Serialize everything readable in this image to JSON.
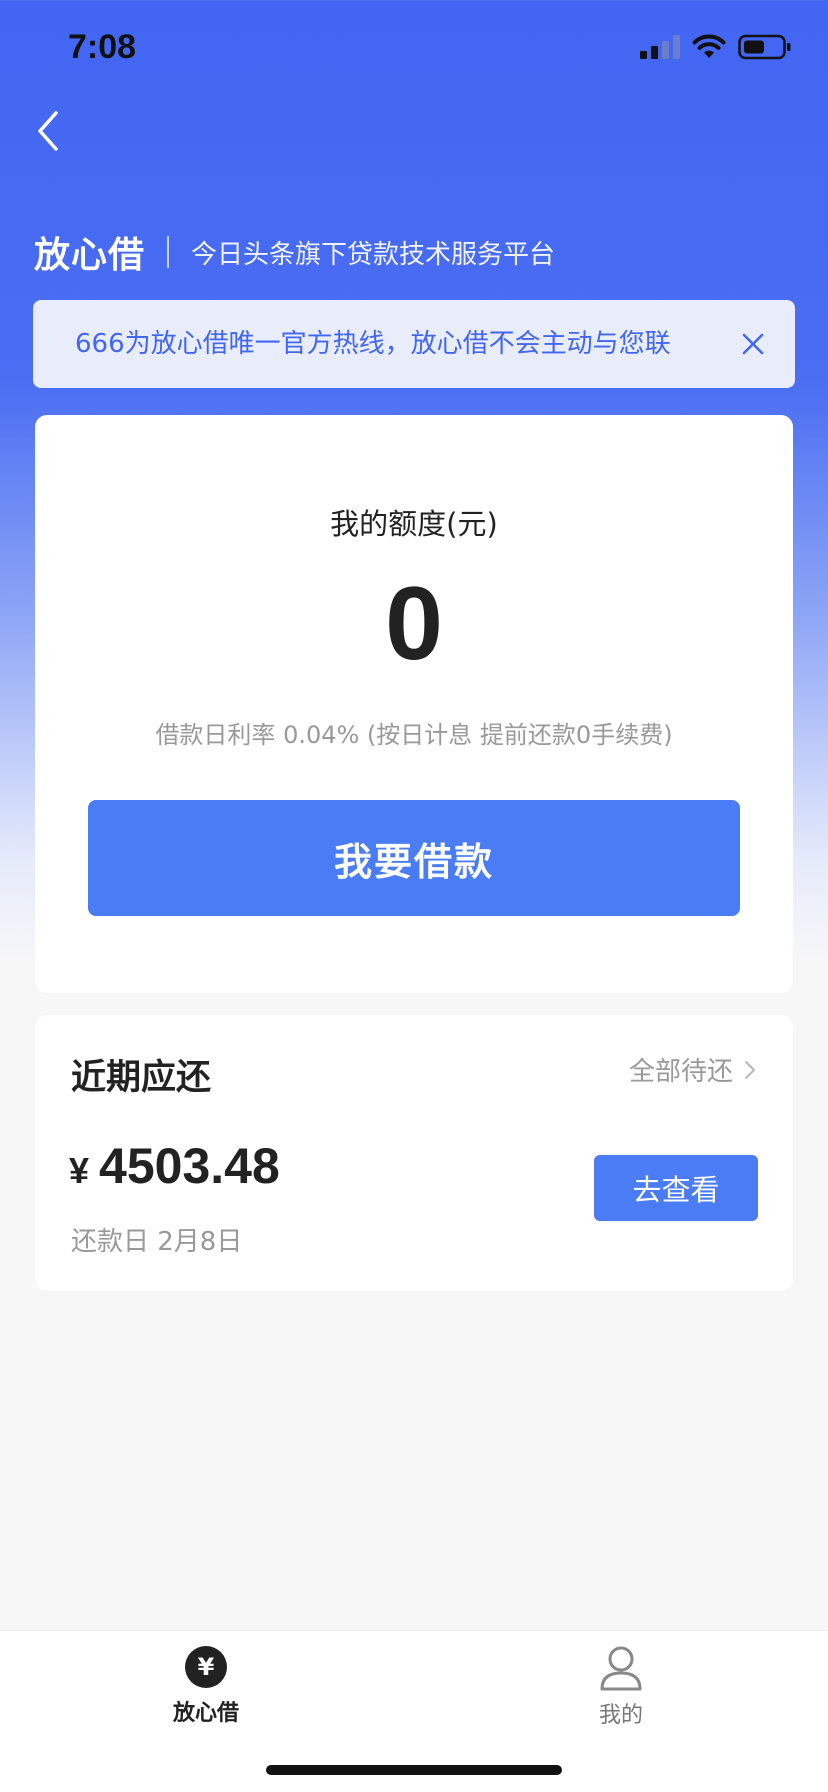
{
  "status_bar": {
    "time": "7:08"
  },
  "header": {
    "brand_name": "放心借",
    "brand_subtitle": "今日头条旗下贷款技术服务平台"
  },
  "notice": {
    "text": "666为放心借唯一官方热线，放心借不会主动与您联"
  },
  "quota": {
    "label": "我的额度(元)",
    "value": "0",
    "rate_text": "借款日利率 0.04% (按日计息 提前还款0手续费)",
    "borrow_button": "我要借款"
  },
  "repay": {
    "title": "近期应还",
    "all_link": "全部待还",
    "currency": "¥",
    "amount": "4503.48",
    "date_text": "还款日 2月8日",
    "view_button": "去查看"
  },
  "tab_bar": {
    "home_label": "放心借",
    "mine_label": "我的"
  },
  "colors": {
    "brand_blue": "#4266f2",
    "button_blue": "#4a7cf5"
  }
}
